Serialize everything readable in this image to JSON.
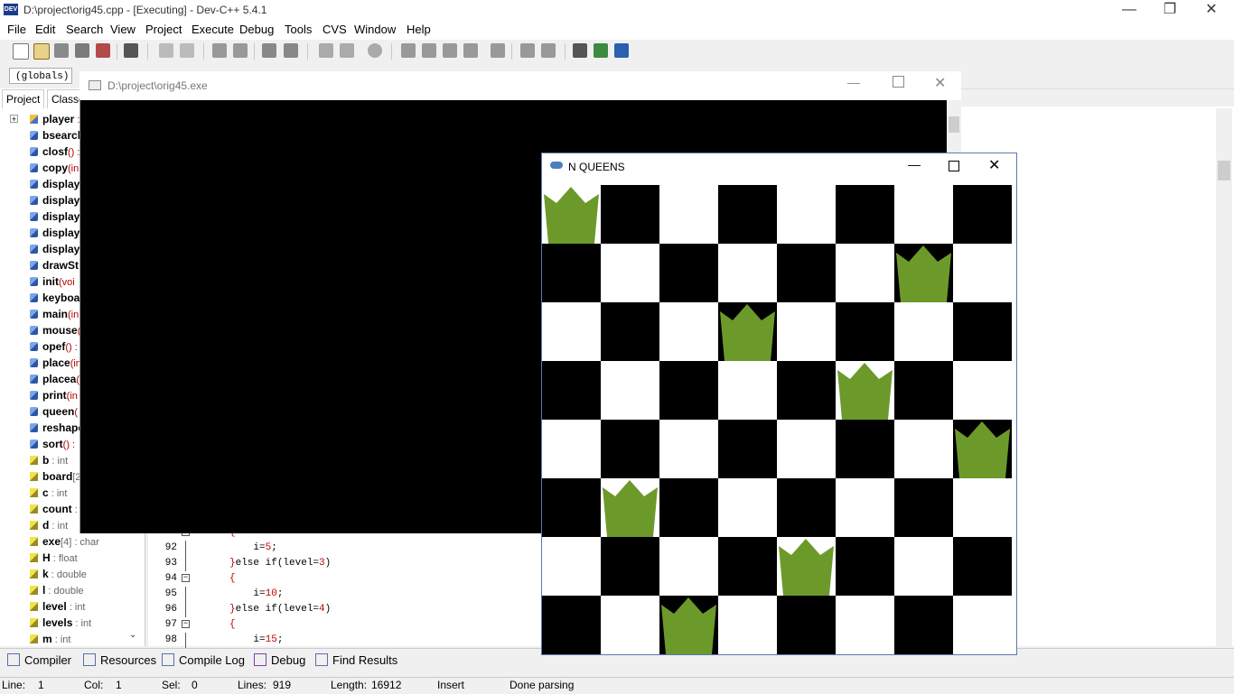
{
  "main_window": {
    "title": "D:\\project\\orig45.cpp - [Executing] - Dev-C++ 5.4.1",
    "app_icon_text": "DEV",
    "minimize": "—",
    "restore": "❐",
    "close": "✕"
  },
  "menu": [
    "File",
    "Edit",
    "Search",
    "View",
    "Project",
    "Execute",
    "Debug",
    "Tools",
    "CVS",
    "Window",
    "Help"
  ],
  "globals_combo": "(globals)",
  "left_tabs": {
    "project": "Project",
    "classes": "Classe"
  },
  "tree": [
    {
      "name": "player",
      "type": " :",
      "kind": "class"
    },
    {
      "name": "bsearch",
      "type": "",
      "kind": "func"
    },
    {
      "name": "closf",
      "type": "() :",
      "kind": "func"
    },
    {
      "name": "copy",
      "type": "(in",
      "kind": "func"
    },
    {
      "name": "display",
      "type": "(",
      "kind": "func"
    },
    {
      "name": "displayb",
      "type": "",
      "kind": "func"
    },
    {
      "name": "displayr",
      "type": "",
      "kind": "func"
    },
    {
      "name": "displayn",
      "type": "",
      "kind": "func"
    },
    {
      "name": "displays",
      "type": "",
      "kind": "func"
    },
    {
      "name": "drawSt",
      "type": "",
      "kind": "func"
    },
    {
      "name": "init",
      "type": "(voi",
      "kind": "func"
    },
    {
      "name": "keyboa",
      "type": "",
      "kind": "func"
    },
    {
      "name": "main",
      "type": "(in",
      "kind": "func"
    },
    {
      "name": "mouse",
      "type": "(",
      "kind": "func"
    },
    {
      "name": "opef",
      "type": "() :",
      "kind": "func"
    },
    {
      "name": "place",
      "type": "(in",
      "kind": "func"
    },
    {
      "name": "placea",
      "type": "(",
      "kind": "func"
    },
    {
      "name": "print",
      "type": "(in",
      "kind": "func"
    },
    {
      "name": "queen",
      "type": "(",
      "kind": "func"
    },
    {
      "name": "reshape",
      "type": "",
      "kind": "func"
    },
    {
      "name": "sort",
      "type": "() :",
      "kind": "func"
    },
    {
      "name": "b",
      "type": " : int",
      "kind": "var"
    },
    {
      "name": "board",
      "type": "[2",
      "kind": "var"
    },
    {
      "name": "c",
      "type": " : int",
      "kind": "var"
    },
    {
      "name": "count",
      "type": " :",
      "kind": "var"
    },
    {
      "name": "d",
      "type": " : int",
      "kind": "var"
    },
    {
      "name": "exe",
      "type": "[4] : char",
      "kind": "var"
    },
    {
      "name": "H",
      "type": " : float",
      "kind": "var"
    },
    {
      "name": "k",
      "type": " : double",
      "kind": "var"
    },
    {
      "name": "l",
      "type": " : double",
      "kind": "var"
    },
    {
      "name": "level",
      "type": " : int",
      "kind": "var"
    },
    {
      "name": "levels",
      "type": " : int",
      "kind": "var"
    },
    {
      "name": "m",
      "type": " : int",
      "kind": "var"
    }
  ],
  "code_lines": [
    {
      "ln": "",
      "text": "{"
    },
    {
      "ln": "92",
      "text": "    i=5;"
    },
    {
      "ln": "93",
      "text": "}else if(level=3)"
    },
    {
      "ln": "94",
      "text": "{"
    },
    {
      "ln": "95",
      "text": "    i=10;"
    },
    {
      "ln": "96",
      "text": "}else if(level=4)"
    },
    {
      "ln": "97",
      "text": "{"
    },
    {
      "ln": "98",
      "text": "    i=15;"
    }
  ],
  "bottom_tabs": [
    "Compiler",
    "Resources",
    "Compile Log",
    "Debug",
    "Find Results"
  ],
  "status": {
    "line_label": "Line:",
    "line": "1",
    "col_label": "Col:",
    "col": "1",
    "sel_label": "Sel:",
    "sel": "0",
    "lines_label": "Lines:",
    "lines": "919",
    "length_label": "Length:",
    "length": "16912",
    "mode": "Insert",
    "msg": "Done parsing"
  },
  "console_window": {
    "title": "D:\\project\\orig45.exe"
  },
  "nqueens_window": {
    "title": "N QUEENS",
    "board_size": 8,
    "queen_color": "#6b9a2a",
    "queens": [
      {
        "row": 0,
        "col": 0
      },
      {
        "row": 1,
        "col": 6
      },
      {
        "row": 2,
        "col": 3
      },
      {
        "row": 3,
        "col": 5
      },
      {
        "row": 4,
        "col": 7
      },
      {
        "row": 5,
        "col": 1
      },
      {
        "row": 6,
        "col": 4
      },
      {
        "row": 7,
        "col": 2
      }
    ]
  }
}
